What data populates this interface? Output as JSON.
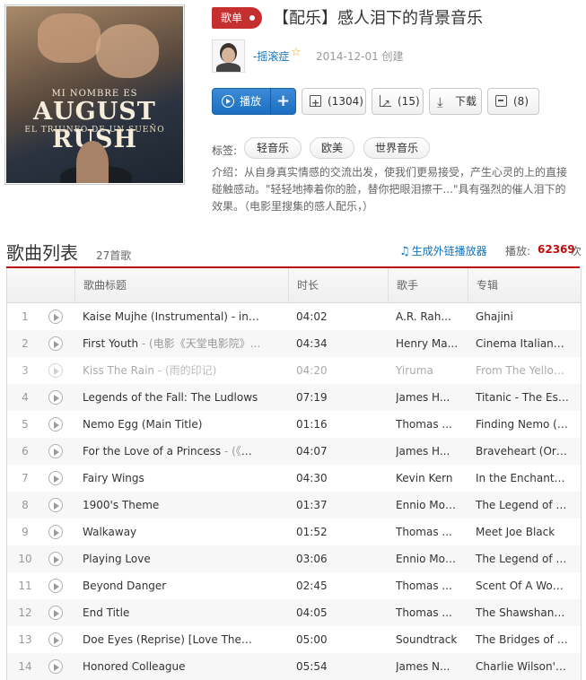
{
  "playlist": {
    "badge": "歌单",
    "title": "【配乐】感人泪下的背景音乐",
    "creator": "-摇滚症",
    "create_date": "2014-12-01 创建",
    "cover": {
      "line1": "MI NOMBRE ES",
      "line2": "AUGUST RUSH",
      "line3": "EL TRIUNFO DE UN SUEÑO"
    },
    "actions": {
      "play": "播放",
      "add": "+",
      "collect": "(1304)",
      "share": "(15)",
      "download": "下载",
      "comment": "(8)"
    },
    "tags_label": "标签:",
    "tags": [
      "轻音乐",
      "欧美",
      "世界音乐"
    ],
    "intro": "介绍：从自身真实情感的交流出发，使我们更易接受，产生心灵的上的直接碰触感动。\"轻轻地捧着你的脸，替你把眼泪擦干...\"具有强烈的催人泪下的效果。（电影里搜集的感人配乐，）"
  },
  "song_list": {
    "heading": "歌曲列表",
    "count": "27首歌",
    "outchain": "生成外链播放器",
    "play_count_label": "播放:",
    "play_count": "62369",
    "play_count_unit": "次",
    "columns": [
      "歌曲标题",
      "时长",
      "歌手",
      "专辑"
    ],
    "rows": [
      {
        "num": "1",
        "title": "Kaise Mujhe (Instrumental) - instr...",
        "sub": "",
        "duration": "04:02",
        "artist": "A.R. Rah...",
        "album": "Ghajini",
        "dim": false
      },
      {
        "num": "2",
        "title": "First Youth",
        "sub": " - (电影《天堂电影院》...",
        "duration": "04:34",
        "artist": "Henry Ma...",
        "album": "Cinema Italiano: ...",
        "dim": false
      },
      {
        "num": "3",
        "title": "Kiss The Rain",
        "sub": " - (雨的印记)",
        "duration": "04:20",
        "artist": "Yiruma",
        "album": "From The Yellow...",
        "dim": true
      },
      {
        "num": "4",
        "title": "Legends of the Fall: The Ludlows",
        "sub": "",
        "duration": "07:19",
        "artist": "James H...",
        "album": "Titanic - The Ess...",
        "dim": false
      },
      {
        "num": "5",
        "title": "Nemo Egg (Main Title)",
        "sub": "",
        "duration": "01:16",
        "artist": "Thomas ...",
        "album": "Finding Nemo (S...",
        "dim": false
      },
      {
        "num": "6",
        "title": "For the Love of a Princess",
        "sub": " - (《勇...",
        "duration": "04:07",
        "artist": "James H...",
        "album": "Braveheart (Origi...",
        "dim": false
      },
      {
        "num": "7",
        "title": "Fairy Wings",
        "sub": "",
        "duration": "04:30",
        "artist": "Kevin Kern",
        "album": "In the Enchanted...",
        "dim": false
      },
      {
        "num": "8",
        "title": "1900's Theme",
        "sub": "",
        "duration": "01:37",
        "artist": "Ennio Mor...",
        "album": "The Legend of 1...",
        "dim": false
      },
      {
        "num": "9",
        "title": "Walkaway",
        "sub": "",
        "duration": "01:52",
        "artist": "Thomas ...",
        "album": "Meet Joe Black",
        "dim": false
      },
      {
        "num": "10",
        "title": "Playing Love",
        "sub": "",
        "duration": "03:06",
        "artist": "Ennio Mor...",
        "album": "The Legend of 1...",
        "dim": false
      },
      {
        "num": "11",
        "title": "Beyond Danger",
        "sub": "",
        "duration": "02:45",
        "artist": "Thomas ...",
        "album": "Scent Of A Woman",
        "dim": false
      },
      {
        "num": "12",
        "title": "End Title",
        "sub": "",
        "duration": "04:05",
        "artist": "Thomas ...",
        "album": "The Shawshank ...",
        "dim": false
      },
      {
        "num": "13",
        "title": "Doe Eyes (Reprise) [Love Theme...",
        "sub": "",
        "duration": "05:00",
        "artist": "Soundtrack",
        "album": "The Bridges of M...",
        "dim": false
      },
      {
        "num": "14",
        "title": "Honored Colleague",
        "sub": "",
        "duration": "05:54",
        "artist": "James N...",
        "album": "Charlie Wilson's ...",
        "dim": false
      }
    ]
  },
  "colors": {
    "accent_red": "#c20c0c",
    "link_blue": "#0c73c2",
    "play_button": "#2a7ad0"
  }
}
